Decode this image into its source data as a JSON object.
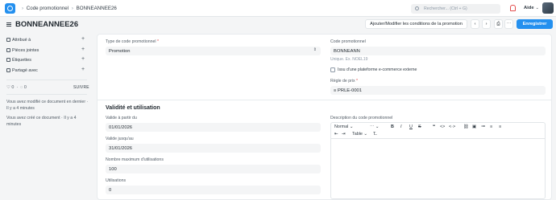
{
  "topbar": {
    "crumb_1": "Code promotionnel",
    "crumb_2": "BONNEANNEE26",
    "search_placeholder": "Rechercher... (Ctrl + G)",
    "help_label": "Aide",
    "help_chevron": "⌄"
  },
  "header": {
    "title": "BONNEANNEE26",
    "conditions_button": "Ajouter/Modifier les conditions de la promotion",
    "prev_icon": "‹",
    "next_icon": "›",
    "print_icon": "⎙",
    "more_icon": "⋯",
    "save_button": "Enregistrer",
    "save_shortcut": "⌘S"
  },
  "sidebar": {
    "items": [
      {
        "label": "Attribué à",
        "icon": "user-icon"
      },
      {
        "label": "Pièces jointes",
        "icon": "paperclip-icon"
      },
      {
        "label": "Étiquettes",
        "icon": "tag-icon"
      },
      {
        "label": "Partagé avec",
        "icon": "share-icon"
      }
    ],
    "plus": "+",
    "likes_count": "0",
    "comments_count": "0",
    "heart_icon": "♡",
    "comment_icon": "◌",
    "follow_label": "SUIVRE",
    "modified_text": "Vous avez modifié ce document en dernier · Il y a 4 minutes",
    "created_text": "Vous avez créé ce document · Il y a 4 minutes"
  },
  "form": {
    "type_label": "Type de code promotionnel",
    "type_value": "Promotion",
    "type_arrow": "⇕",
    "code_label": "Code promotionnel",
    "code_value": "BONNEANN",
    "code_hint": "Unique. Ex. NOEL19",
    "external_label": "Issu d'une plateforme e-commerce externe",
    "price_rule_label": "Règle de prix",
    "price_rule_value": "PRLE-0001",
    "price_rule_prefix": "≡",
    "section_title": "Validité et utilisation",
    "valid_from_label": "Valide à partir du",
    "valid_from_value": "01/01/2026",
    "valid_to_label": "Valide jusqu'au",
    "valid_to_value": "31/01/2026",
    "max_use_label": "Nombre maximum d'utilisations",
    "max_use_value": "100",
    "used_label": "Utilisations",
    "used_value": "0",
    "description_label": "Description du code promotionnel"
  },
  "editor": {
    "format_select": "Normal",
    "font_size_select": "⋯",
    "bold": "B",
    "italic": "I",
    "underline": "U",
    "strike": "S",
    "quote": "❝",
    "code": "<>",
    "code_block": "<·>",
    "link_icon": "⛓",
    "image_icon": "▣",
    "list_ordered_icon": "≔",
    "list_bullet_icon": "≡",
    "align_icon": "≡",
    "indent_icon": "⇤",
    "outdent_icon": "⇥",
    "table_label": "Table",
    "table_chevron": "⌄",
    "clear_format_icon": "T̶",
    "more_label": "⌄"
  },
  "colors": {
    "accent": "#2490ef",
    "required": "#e24c4c"
  }
}
